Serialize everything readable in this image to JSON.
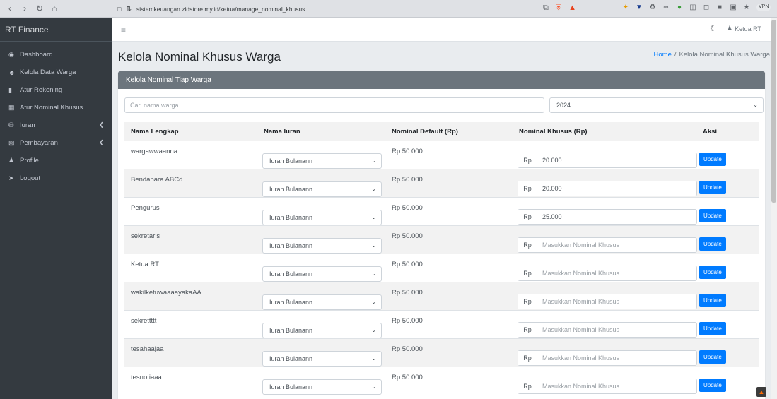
{
  "browser": {
    "url": "sistemkeuangan.zidstore.my.id/ketua/manage_nominal_khusus",
    "vpn_label": "VPN"
  },
  "sidebar": {
    "brand": "RT Finance",
    "items": [
      {
        "label": "Dashboard",
        "icon": "dashboard-icon"
      },
      {
        "label": "Kelola Data Warga",
        "icon": "users-icon"
      },
      {
        "label": "Atur Rekening",
        "icon": "card-icon"
      },
      {
        "label": "Atur Nominal Khusus",
        "icon": "calculator-icon"
      },
      {
        "label": "Iuran",
        "icon": "coins-icon",
        "has_submenu": true
      },
      {
        "label": "Pembayaran",
        "icon": "money-icon",
        "has_submenu": true
      },
      {
        "label": "Profile",
        "icon": "user-icon"
      },
      {
        "label": "Logout",
        "icon": "logout-icon"
      }
    ]
  },
  "topbar": {
    "user_label": "Ketua RT"
  },
  "header": {
    "title": "Kelola Nominal Khusus Warga",
    "breadcrumb_home": "Home",
    "breadcrumb_sep": "/",
    "breadcrumb_current": "Kelola Nominal Khusus Warga"
  },
  "card": {
    "title": "Kelola Nominal Tiap Warga",
    "search_placeholder": "Cari nama warga...",
    "year_selected": "2024"
  },
  "table": {
    "headers": [
      "Nama Lengkap",
      "Nama Iuran",
      "Nominal Default (Rp)",
      "Nominal Khusus (Rp)",
      "Aksi"
    ],
    "prefix": "Rp",
    "placeholder": "Masukkan Nominal Khusus",
    "update_label": "Update",
    "rows": [
      {
        "name": "wargawwaanna",
        "iuran": "Iuran Bulanann",
        "default": "Rp 50.000",
        "khusus": "20.000"
      },
      {
        "name": "Bendahara ABCd",
        "iuran": "Iuran Bulanann",
        "default": "Rp 50.000",
        "khusus": "20.000"
      },
      {
        "name": "Pengurus",
        "iuran": "Iuran Bulanann",
        "default": "Rp 50.000",
        "khusus": "25.000"
      },
      {
        "name": "sekretaris",
        "iuran": "Iuran Bulanann",
        "default": "Rp 50.000",
        "khusus": ""
      },
      {
        "name": "Ketua RT",
        "iuran": "Iuran Bulanann",
        "default": "Rp 50.000",
        "khusus": ""
      },
      {
        "name": "wakilketuwaaaayakaAA",
        "iuran": "Iuran Bulanann",
        "default": "Rp 50.000",
        "khusus": ""
      },
      {
        "name": "sekrettttt",
        "iuran": "Iuran Bulanann",
        "default": "Rp 50.000",
        "khusus": ""
      },
      {
        "name": "tesahaajaa",
        "iuran": "Iuran Bulanann",
        "default": "Rp 50.000",
        "khusus": ""
      },
      {
        "name": "tesnotiaaa",
        "iuran": "Iuran Bulanann",
        "default": "Rp 50.000",
        "khusus": ""
      }
    ]
  }
}
